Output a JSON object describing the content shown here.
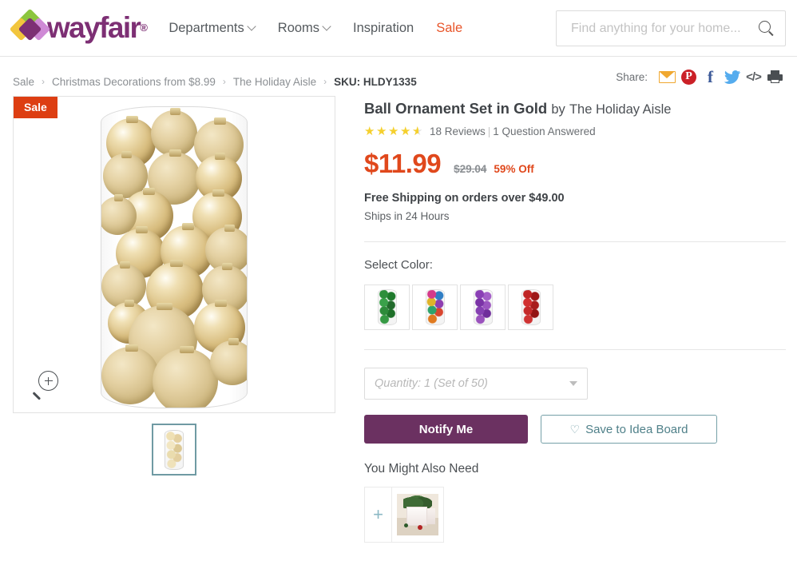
{
  "header": {
    "logo_text": "wayfair",
    "logo_trademark": "®",
    "nav": [
      {
        "label": "Departments",
        "has_caret": true,
        "accent": false
      },
      {
        "label": "Rooms",
        "has_caret": true,
        "accent": false
      },
      {
        "label": "Inspiration",
        "has_caret": false,
        "accent": false
      },
      {
        "label": "Sale",
        "has_caret": false,
        "accent": true
      }
    ],
    "search": {
      "placeholder": "Find anything for your home...",
      "value": "",
      "icon": "search-icon"
    }
  },
  "breadcrumb": {
    "separator": "›",
    "items": [
      {
        "label": "Sale",
        "current": false
      },
      {
        "label": "Christmas Decorations from $8.99",
        "current": false
      },
      {
        "label": "The Holiday Aisle",
        "current": false
      },
      {
        "label": "SKU: HLDY1335",
        "current": true
      }
    ]
  },
  "share": {
    "label": "Share:",
    "icons": [
      {
        "name": "email-icon",
        "glyph": ""
      },
      {
        "name": "pinterest-icon",
        "glyph": "P"
      },
      {
        "name": "facebook-icon",
        "glyph": "f"
      },
      {
        "name": "twitter-icon",
        "glyph": "ᵕ"
      },
      {
        "name": "embed-code-icon",
        "glyph": "</>"
      },
      {
        "name": "print-icon",
        "glyph": ""
      }
    ]
  },
  "gallery": {
    "sale_badge": "Sale",
    "zoom_icon": "magnifier-plus-icon",
    "hero_alt": "Gold ball ornament set in clear tube",
    "thumbnails": [
      {
        "selected": true,
        "alt": "Gold ball ornament set thumbnail"
      }
    ]
  },
  "product": {
    "title": "Ball Ornament Set in Gold",
    "by_prefix": "by",
    "brand": "The Holiday Aisle",
    "rating": 4.5,
    "stars_full": 4,
    "stars_half": 1,
    "reviews_text": "18 Reviews",
    "review_separator": "|",
    "questions_text": "1 Question Answered",
    "price": "$11.99",
    "price_was": "$29.04",
    "discount": "59% Off",
    "shipping": "Free Shipping on orders over $49.00",
    "ships_in": "Ships in 24 Hours"
  },
  "options": {
    "color_label": "Select Color:",
    "colors": [
      {
        "name": "Green",
        "swatch_class": "sw-green",
        "selected": false
      },
      {
        "name": "Multicolor",
        "swatch_class": "sw-multi",
        "selected": false
      },
      {
        "name": "Purple",
        "swatch_class": "sw-purple",
        "selected": false
      },
      {
        "name": "Red",
        "swatch_class": "sw-red",
        "selected": false
      }
    ],
    "quantity_value": "Quantity: 1 (Set of 50)"
  },
  "actions": {
    "notify_label": "Notify Me",
    "save_label": "Save to Idea Board",
    "save_icon": "heart-icon",
    "heart_glyph": "♡"
  },
  "also_need": {
    "title": "You Might Also Need",
    "plus_glyph": "+",
    "items": [
      {
        "alt": "Christmas tree collar"
      }
    ]
  },
  "colors": {
    "brand_purple": "#7d2f74",
    "button_purple": "#6b3161",
    "sale_red": "#dd3e12",
    "price_orange": "#e0481c",
    "accent_teal": "#76a0a8",
    "star_yellow": "#f5d02e",
    "text_dark": "#3f4347",
    "text_muted": "#8b8f93"
  }
}
